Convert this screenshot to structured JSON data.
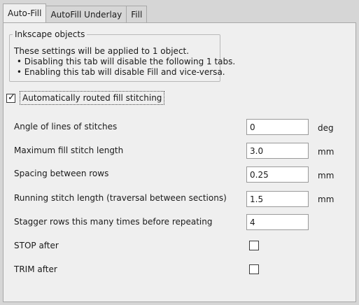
{
  "tabs": [
    {
      "label": "Auto-Fill",
      "active": true
    },
    {
      "label": "AutoFill Underlay",
      "active": false
    },
    {
      "label": "Fill",
      "active": false
    }
  ],
  "objects_group": {
    "legend": "Inkscape objects",
    "lines": [
      "These settings will be applied to 1 object.",
      " • Disabling this tab will disable the following 1 tabs.",
      " • Enabling this tab will disable Fill and vice-versa."
    ]
  },
  "auto_route": {
    "label": "Automatically routed fill stitching",
    "checked": true,
    "check_glyph": "✓"
  },
  "params": [
    {
      "label": "Angle of lines of stitches",
      "value": "0",
      "unit": "deg"
    },
    {
      "label": "Maximum fill stitch length",
      "value": "3.0",
      "unit": "mm"
    },
    {
      "label": "Spacing between rows",
      "value": "0.25",
      "unit": "mm"
    },
    {
      "label": "Running stitch length (traversal between sections)",
      "value": "1.5",
      "unit": "mm"
    },
    {
      "label": "Stagger rows this many times before repeating",
      "value": "4",
      "unit": ""
    }
  ],
  "toggles": [
    {
      "label": "STOP after",
      "checked": false
    },
    {
      "label": "TRIM after",
      "checked": false
    }
  ]
}
